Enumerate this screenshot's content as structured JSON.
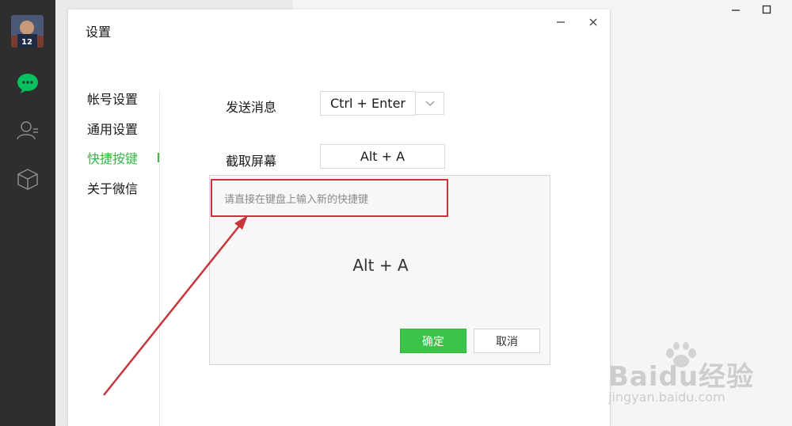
{
  "settings": {
    "title": "设置",
    "nav": [
      "帐号设置",
      "通用设置",
      "快捷按键",
      "关于微信"
    ],
    "active_nav": "快捷按键"
  },
  "shortcuts": {
    "send_label": "发送消息",
    "send_value": "Ctrl + Enter",
    "capture_label": "截取屏幕",
    "capture_value": "Alt + A"
  },
  "dialog": {
    "hint": "请直接在键盘上输入新的快捷键",
    "captured": "Alt + A",
    "ok_label": "确定",
    "cancel_label": "取消"
  },
  "watermark": {
    "brand": "Baidu经验",
    "url": "jingyan.baidu.com"
  },
  "colors": {
    "accent": "#39b54a",
    "ok_button": "#3cc44a",
    "annotation": "#c8343a",
    "sidebar": "#2e2e2e"
  },
  "icons": [
    "chat-icon",
    "contacts-icon",
    "box-icon",
    "minimize-icon",
    "maximize-icon",
    "close-icon",
    "chevron-down-icon"
  ]
}
